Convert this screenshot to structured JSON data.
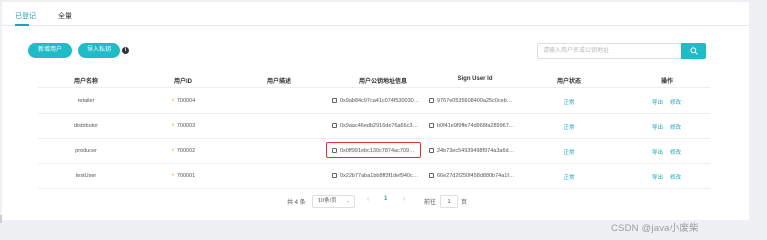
{
  "tabs": [
    {
      "label": "已登记"
    },
    {
      "label": "全量"
    }
  ],
  "toolbar": {
    "add_user_label": "新增用户",
    "import_key_label": "导入私钥",
    "info_icon": "info-icon",
    "search_placeholder": "请输入用户名或公钥地址",
    "search_icon": "search-icon"
  },
  "table": {
    "columns": [
      "用户名称",
      "用户ID",
      "用户描述",
      "用户公钥地址信息",
      "Sign User Id",
      "用户状态",
      "操作"
    ],
    "rows": [
      {
        "name": "retailer",
        "id": "700004",
        "desc": "",
        "address": "0x9ab84c97ca41c074f530030…",
        "sign_id": "9767e0535608400a25c0ceb…",
        "status": "正常",
        "export": "导出",
        "edit": "修改"
      },
      {
        "name": "distributor",
        "id": "700003",
        "desc": "",
        "address": "0x9aac46edb2916de76a66c3…",
        "sign_id": "b0f41e9f9ffe74d968fa289967…",
        "status": "正常",
        "export": "导出",
        "edit": "修改"
      },
      {
        "name": "producer",
        "id": "700002",
        "desc": "",
        "address": "0x0ff991ebc130c7874ac709…",
        "sign_id": "24b73ec54939498f974a3a6d…",
        "status": "正常",
        "export": "导出",
        "edit": "修改"
      },
      {
        "name": "testUser",
        "id": "700001",
        "desc": "",
        "address": "0x22b77aba1bb8ff3f1def940c…",
        "sign_id": "66e27d2f250f458d880b74a1f…",
        "status": "正常",
        "export": "导出",
        "edit": "修改"
      }
    ]
  },
  "pagination": {
    "total_text": "共 4 条",
    "page_size": "10条/页",
    "current_page": "1",
    "goto_label": "前往",
    "goto_value": "1",
    "page_suffix": "页"
  },
  "watermark": "CSDN @java小废柴",
  "colors": {
    "accent": "#1fbcc8",
    "highlight": "#d9342b",
    "bolt": "#e6a23c"
  }
}
